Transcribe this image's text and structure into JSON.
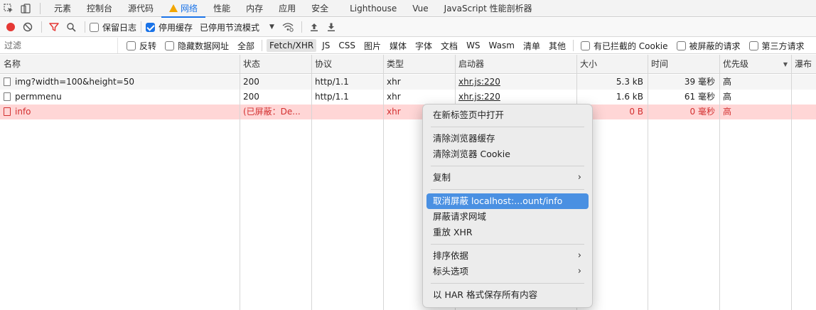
{
  "tabs": [
    {
      "label": "元素"
    },
    {
      "label": "控制台"
    },
    {
      "label": "源代码"
    },
    {
      "label": "网络"
    },
    {
      "label": "性能"
    },
    {
      "label": "内存"
    },
    {
      "label": "应用"
    },
    {
      "label": "安全"
    },
    {
      "label": "Lighthouse"
    },
    {
      "label": "Vue"
    },
    {
      "label": "JavaScript 性能剖析器"
    }
  ],
  "toolbar": {
    "preserve_log": "保留日志",
    "disable_cache": "停用缓存",
    "throttle": "已停用节流模式"
  },
  "filter": {
    "placeholder": "过滤",
    "invert": "反转",
    "hide_data_urls": "隐藏数据网址",
    "types": [
      "全部",
      "Fetch/XHR",
      "JS",
      "CSS",
      "图片",
      "媒体",
      "字体",
      "文档",
      "WS",
      "Wasm",
      "清单",
      "其他"
    ],
    "blocked_cookies": "有已拦截的 Cookie",
    "blocked_requests": "被屏蔽的请求",
    "third_party": "第三方请求"
  },
  "columns": [
    "名称",
    "状态",
    "协议",
    "类型",
    "启动器",
    "大小",
    "时间",
    "优先级",
    "瀑布"
  ],
  "rows": [
    {
      "name": "img?width=100&height=50",
      "status": "200",
      "protocol": "http/1.1",
      "type": "xhr",
      "initiator": "xhr.js:220",
      "size": "5.3 kB",
      "time": "39 毫秒",
      "priority": "高"
    },
    {
      "name": "permmenu",
      "status": "200",
      "protocol": "http/1.1",
      "type": "xhr",
      "initiator": "xhr.js:220",
      "size": "1.6 kB",
      "time": "61 毫秒",
      "priority": "高"
    },
    {
      "name": "info",
      "status": "(已屏蔽：De...",
      "protocol": "",
      "type": "xhr",
      "initiator": "",
      "size": "0 B",
      "time": "0 毫秒",
      "priority": "高"
    }
  ],
  "context_menu": {
    "open_new_tab": "在新标签页中打开",
    "clear_cache": "清除浏览器缓存",
    "clear_cookies": "清除浏览器 Cookie",
    "copy": "复制",
    "unblock": "取消屏蔽 localhost:...ount/info",
    "block_domain": "屏蔽请求网域",
    "replay_xhr": "重放 XHR",
    "sort_by": "排序依据",
    "header_options": "标头选项",
    "save_har": "以 HAR 格式保存所有内容"
  },
  "colors": {
    "accent": "#1a73e8",
    "record_red": "#e53935",
    "blocked_row_bg": "#ffd6d6",
    "blocked_text": "#d32f2f",
    "menu_highlight": "#4a90e2"
  }
}
